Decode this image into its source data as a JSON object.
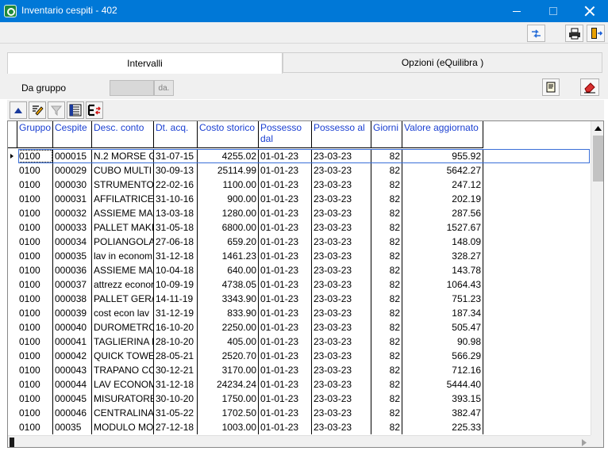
{
  "window": {
    "title": "Inventario cespiti - 402",
    "minimize_icon": "minimize-icon",
    "maximize_icon": "maximize-icon",
    "close_icon": "close-icon",
    "title_bar_color": "#0078d7"
  },
  "toolbar": {
    "refresh_icon": "refresh-arrows-icon",
    "print_icon": "printer-icon",
    "exit_icon": "exit-door-icon"
  },
  "tabs": [
    {
      "label": "Intervalli",
      "active": true
    },
    {
      "label": "Opzioni (eQuilibra )",
      "active": false
    }
  ],
  "filter": {
    "da_gruppo_label": "Da gruppo",
    "da_gruppo_value": "",
    "da_button_label": "da.",
    "note_icon": "document-note-icon",
    "erase_icon": "eraser-icon"
  },
  "grid_toolbar": {
    "icons": [
      "up-arrow-icon",
      "edit-check-icon",
      "filter-icon",
      "list-settings-icon",
      "export-excel-icon"
    ]
  },
  "grid": {
    "header_color": "#1a3fd1",
    "columns": [
      "Gruppo",
      "Cespite",
      "Desc. conto",
      "Dt. acq.",
      "Costo storico",
      "Possesso dal",
      "Possesso al",
      "Giorni",
      "Valore aggiornato"
    ],
    "rows": [
      [
        "0100",
        "000015",
        "N.2 MORSE G",
        "31-07-15",
        "4255.02",
        "01-01-23",
        "23-03-23",
        "82",
        "955.92"
      ],
      [
        "0100",
        "000029",
        "CUBO MULTI",
        "30-09-13",
        "25114.99",
        "01-01-23",
        "23-03-23",
        "82",
        "5642.27"
      ],
      [
        "0100",
        "000030",
        "STRUMENTO",
        "22-02-16",
        "1100.00",
        "01-01-23",
        "23-03-23",
        "82",
        "247.12"
      ],
      [
        "0100",
        "000031",
        "AFFILATRICE",
        "31-10-16",
        "900.00",
        "01-01-23",
        "23-03-23",
        "82",
        "202.19"
      ],
      [
        "0100",
        "000032",
        "ASSIEME MAN",
        "13-03-18",
        "1280.00",
        "01-01-23",
        "23-03-23",
        "82",
        "287.56"
      ],
      [
        "0100",
        "000033",
        "PALLET MAKI",
        "31-05-18",
        "6800.00",
        "01-01-23",
        "23-03-23",
        "82",
        "1527.67"
      ],
      [
        "0100",
        "000034",
        "POLIANGOLA",
        "27-06-18",
        "659.20",
        "01-01-23",
        "23-03-23",
        "82",
        "148.09"
      ],
      [
        "0100",
        "000035",
        "lav in econom",
        "31-12-18",
        "1461.23",
        "01-01-23",
        "23-03-23",
        "82",
        "328.27"
      ],
      [
        "0100",
        "000036",
        "ASSIEME MAN",
        "10-04-18",
        "640.00",
        "01-01-23",
        "23-03-23",
        "82",
        "143.78"
      ],
      [
        "0100",
        "000037",
        "attrezz econor",
        "10-09-19",
        "4738.05",
        "01-01-23",
        "23-03-23",
        "82",
        "1064.43"
      ],
      [
        "0100",
        "000038",
        "PALLET GER/",
        "14-11-19",
        "3343.90",
        "01-01-23",
        "23-03-23",
        "82",
        "751.23"
      ],
      [
        "0100",
        "000039",
        "cost econ lav",
        "31-12-19",
        "833.90",
        "01-01-23",
        "23-03-23",
        "82",
        "187.34"
      ],
      [
        "0100",
        "000040",
        "DUROMETRO",
        "16-10-20",
        "2250.00",
        "01-01-23",
        "23-03-23",
        "82",
        "505.47"
      ],
      [
        "0100",
        "000041",
        "TAGLIERINA E",
        "28-10-20",
        "405.00",
        "01-01-23",
        "23-03-23",
        "82",
        "90.98"
      ],
      [
        "0100",
        "000042",
        "QUICK TOWE",
        "28-05-21",
        "2520.70",
        "01-01-23",
        "23-03-23",
        "82",
        "566.29"
      ],
      [
        "0100",
        "000043",
        "TRAPANO CC",
        "30-12-21",
        "3170.00",
        "01-01-23",
        "23-03-23",
        "82",
        "712.16"
      ],
      [
        "0100",
        "000044",
        "LAV ECONOM",
        "31-12-18",
        "24234.24",
        "01-01-23",
        "23-03-23",
        "82",
        "5444.40"
      ],
      [
        "0100",
        "000045",
        "MISURATORE",
        "30-10-20",
        "1750.00",
        "01-01-23",
        "23-03-23",
        "82",
        "393.15"
      ],
      [
        "0100",
        "000046",
        "CENTRALINA",
        "31-05-22",
        "1702.50",
        "01-01-23",
        "23-03-23",
        "82",
        "382.47"
      ],
      [
        "0100",
        "00035",
        "MODULO MOT",
        "27-12-18",
        "1003.00",
        "01-01-23",
        "23-03-23",
        "82",
        "225.33"
      ]
    ]
  }
}
